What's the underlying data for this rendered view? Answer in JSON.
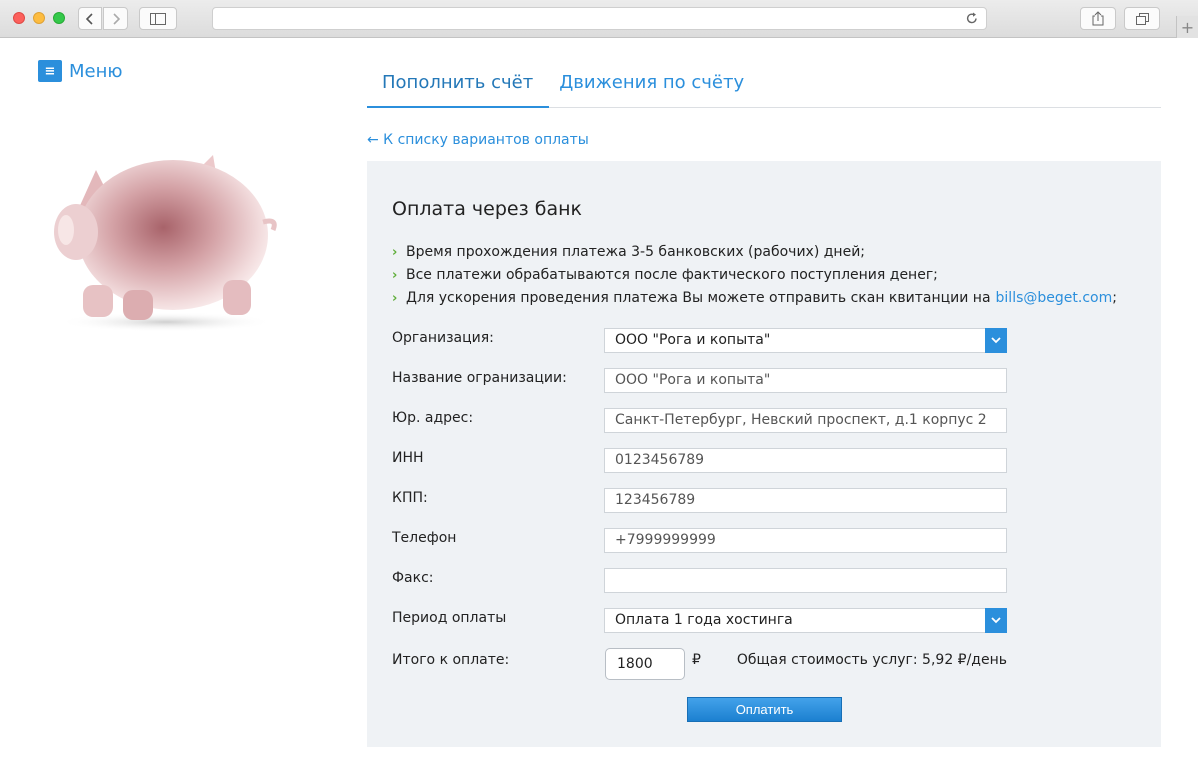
{
  "menu": {
    "label": "Меню"
  },
  "tabs": [
    {
      "label": "Пополнить счёт"
    },
    {
      "label": "Движения по счёту"
    }
  ],
  "back_link": "← К списку вариантов оплаты",
  "panel": {
    "title": "Оплата через банк",
    "bullets": [
      "Время прохождения платежа 3-5 банковских (рабочих) дней;",
      "Все платежи обрабатываются после фактического поступления денег;",
      "Для ускорения проведения платежа Вы можете отправить скан квитанции на"
    ],
    "email": "bills@beget.com",
    "email_suffix": ";"
  },
  "form": {
    "organization": {
      "label": "Организация:",
      "value": "ООО \"Рога и копыта\""
    },
    "org_name": {
      "label": "Название огранизации:",
      "value": "ООО \"Рога и копыта\""
    },
    "address": {
      "label": "Юр. адрес:",
      "value": "Санкт-Петербург, Невский проспект, д.1 корпус 2"
    },
    "inn": {
      "label": "ИНН",
      "value": "0123456789"
    },
    "kpp": {
      "label": "КПП:",
      "value": "123456789"
    },
    "phone": {
      "label": "Телефон",
      "value": "+7999999999"
    },
    "fax": {
      "label": "Факс:",
      "value": ""
    },
    "period": {
      "label": "Период оплаты",
      "value": "Оплата 1 года хостинга"
    },
    "total": {
      "label": "Итого к оплате:",
      "value": "1800",
      "currency": "₽",
      "summary": "Общая стоимость услуг: 5,92 ₽/день"
    }
  },
  "pay_button": "Оплатить",
  "colors": {
    "accent": "#2b8fdc",
    "panel_bg": "#eff2f5",
    "bullet": "#5fae3a"
  }
}
